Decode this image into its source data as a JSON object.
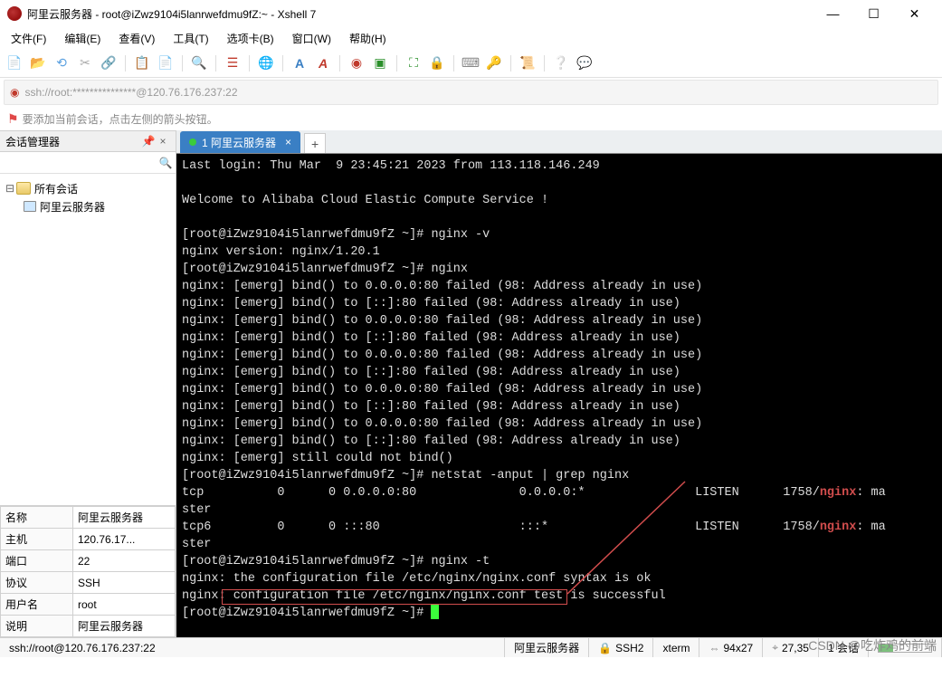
{
  "title": "阿里云服务器 - root@iZwz9104i5lanrwefdmu9fZ:~ - Xshell 7",
  "menu": {
    "file": "文件(F)",
    "edit": "编辑(E)",
    "view": "查看(V)",
    "tools": "工具(T)",
    "tabs": "选项卡(B)",
    "window": "窗口(W)",
    "help": "帮助(H)"
  },
  "address_bar": "ssh://root:***************@120.76.176.237:22",
  "info_hint": "要添加当前会话，点击左侧的箭头按钮。",
  "sidebar": {
    "panel_title": "会话管理器",
    "root_label": "所有会话",
    "session_label": "阿里云服务器",
    "search_placeholder": ""
  },
  "properties": {
    "rows": [
      {
        "k": "名称",
        "v": "阿里云服务器"
      },
      {
        "k": "主机",
        "v": "120.76.17..."
      },
      {
        "k": "端口",
        "v": "22"
      },
      {
        "k": "协议",
        "v": "SSH"
      },
      {
        "k": "用户名",
        "v": "root"
      },
      {
        "k": "说明",
        "v": "阿里云服务器"
      }
    ]
  },
  "tab": {
    "label": "1 阿里云服务器"
  },
  "terminal_lines": [
    "Last login: Thu Mar  9 23:45:21 2023 from 113.118.146.249",
    "",
    "Welcome to Alibaba Cloud Elastic Compute Service !",
    "",
    "[root@iZwz9104i5lanrwefdmu9fZ ~]# nginx -v",
    "nginx version: nginx/1.20.1",
    "[root@iZwz9104i5lanrwefdmu9fZ ~]# nginx",
    "nginx: [emerg] bind() to 0.0.0.0:80 failed (98: Address already in use)",
    "nginx: [emerg] bind() to [::]:80 failed (98: Address already in use)",
    "nginx: [emerg] bind() to 0.0.0.0:80 failed (98: Address already in use)",
    "nginx: [emerg] bind() to [::]:80 failed (98: Address already in use)",
    "nginx: [emerg] bind() to 0.0.0.0:80 failed (98: Address already in use)",
    "nginx: [emerg] bind() to [::]:80 failed (98: Address already in use)",
    "nginx: [emerg] bind() to 0.0.0.0:80 failed (98: Address already in use)",
    "nginx: [emerg] bind() to [::]:80 failed (98: Address already in use)",
    "nginx: [emerg] bind() to 0.0.0.0:80 failed (98: Address already in use)",
    "nginx: [emerg] bind() to [::]:80 failed (98: Address already in use)",
    "nginx: [emerg] still could not bind()",
    "[root@iZwz9104i5lanrwefdmu9fZ ~]# netstat -anput | grep nginx"
  ],
  "terminal_net": [
    {
      "proto": "tcp",
      "recv": "0",
      "send": "0",
      "local": "0.0.0.0:80",
      "foreign": "0.0.0.0:*",
      "state": "LISTEN",
      "pid": "1758/",
      "proc": "nginx",
      "tail": ": ma"
    },
    {
      "cont": "ster"
    },
    {
      "proto": "tcp6",
      "recv": "0",
      "send": "0",
      "local": ":::80",
      "foreign": ":::*",
      "state": "LISTEN",
      "pid": "1758/",
      "proc": "nginx",
      "tail": ": ma"
    },
    {
      "cont": "ster"
    }
  ],
  "terminal_tail": [
    "[root@iZwz9104i5lanrwefdmu9fZ ~]# nginx -t",
    "nginx: the configuration file /etc/nginx/nginx.conf syntax is ok",
    "nginx: configuration file /etc/nginx/nginx.conf test is successful",
    "[root@iZwz9104i5lanrwefdmu9fZ ~]# "
  ],
  "status": {
    "path": "ssh://root@120.76.176.237:22",
    "host": "阿里云服务器",
    "ssh": "SSH2",
    "term": "xterm",
    "size": "94x27",
    "pos": "27,35",
    "sessions": "1 会话"
  },
  "watermark": "CSDN @吃炸鸡的前端"
}
